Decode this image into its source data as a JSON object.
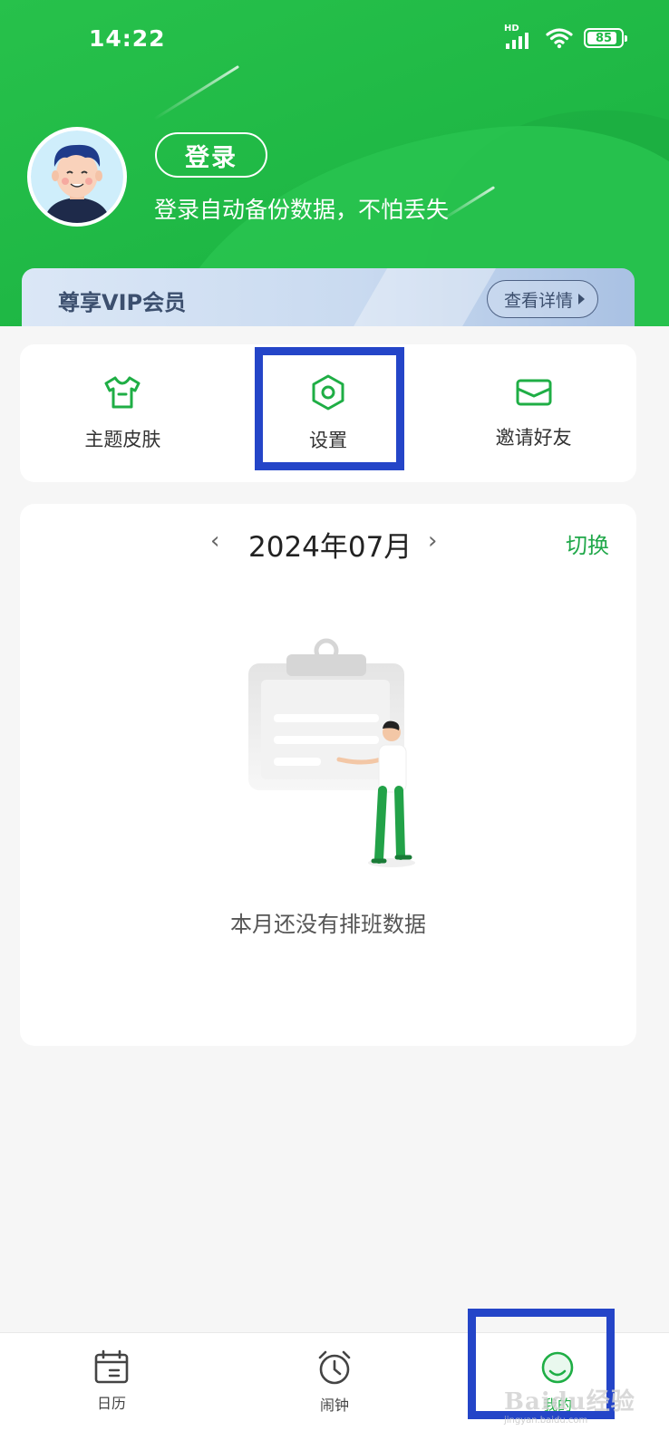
{
  "status_bar": {
    "time": "14:22",
    "network_label": "HD",
    "battery_level": "85"
  },
  "profile": {
    "login_button": "登录",
    "login_subtitle": "登录自动备份数据，不怕丢失"
  },
  "vip": {
    "title": "尊享VIP会员",
    "details_button": "查看详情"
  },
  "features": [
    {
      "label": "主题皮肤",
      "icon": "tshirt-icon"
    },
    {
      "label": "设置",
      "icon": "hexagon-settings-icon"
    },
    {
      "label": "邀请好友",
      "icon": "envelope-icon"
    }
  ],
  "calendar": {
    "month": "2024年07月",
    "switch_label": "切换",
    "empty_message": "本月还没有排班数据"
  },
  "bottom_nav": [
    {
      "label": "日历",
      "icon": "calendar-icon"
    },
    {
      "label": "闹钟",
      "icon": "alarm-clock-icon"
    },
    {
      "label": "我的",
      "icon": "profile-face-icon",
      "active": true
    }
  ],
  "watermark": {
    "brand": "Baidu经验",
    "url": "jingyan.baidu.com"
  },
  "colors": {
    "primary_green": "#1fb845",
    "highlight_blue": "#2445c8",
    "vip_text": "#3c4f6e"
  }
}
